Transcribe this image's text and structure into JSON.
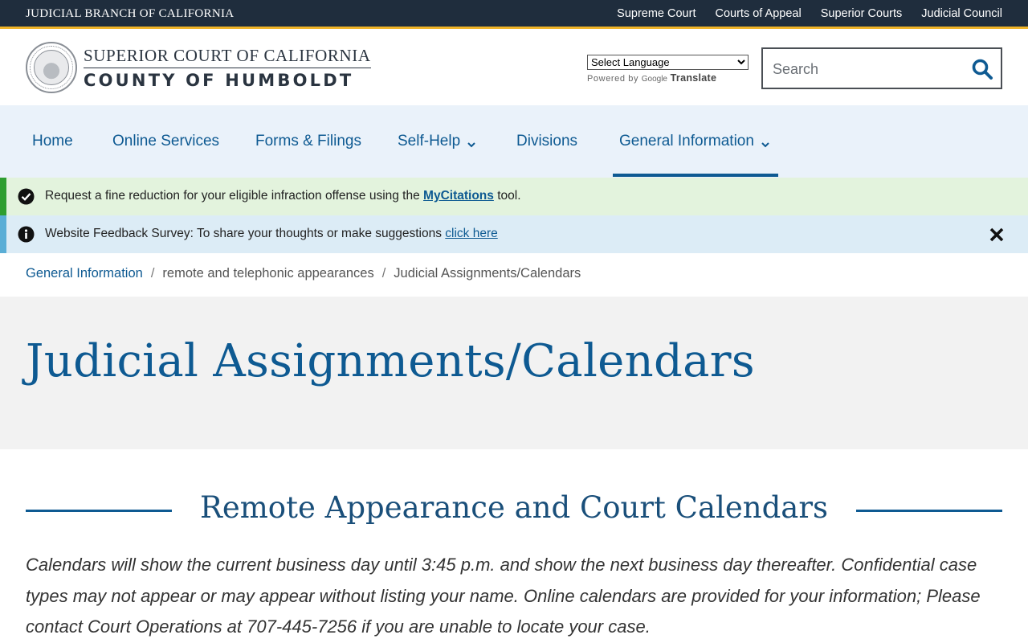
{
  "topbar": {
    "branch": "JUDICIAL BRANCH OF CALIFORNIA",
    "links": [
      "Supreme Court",
      "Courts of Appeal",
      "Superior Courts",
      "Judicial Council"
    ]
  },
  "header": {
    "court_line1": "SUPERIOR COURT OF CALIFORNIA",
    "court_line2": "COUNTY OF HUMBOLDT",
    "translate": {
      "selected": "Select Language",
      "powered_by": "Powered by",
      "google": "Google",
      "translate": "Translate"
    },
    "search": {
      "placeholder": "Search"
    }
  },
  "nav": {
    "items": [
      {
        "label": "Home"
      },
      {
        "label": "Online Services"
      },
      {
        "label": "Forms & Filings"
      },
      {
        "label": "Self-Help"
      },
      {
        "label": "Divisions"
      },
      {
        "label": "General Information"
      }
    ],
    "active": "General Information"
  },
  "alerts": {
    "green": {
      "text_before": "Request  a fine reduction for your eligible infraction offense using the ",
      "link": "MyCitations",
      "text_after": " tool."
    },
    "blue": {
      "text_before": "Website Feedback Survey: To share your thoughts or make suggestions ",
      "link": "click here"
    }
  },
  "breadcrumb": {
    "items": [
      "General Information",
      "remote and telephonic appearances",
      "Judicial Assignments/Calendars"
    ],
    "separator": "/"
  },
  "page": {
    "title": "Judicial Assignments/Calendars",
    "section_title": "Remote Appearance and Court Calendars",
    "body": "Calendars will show the current business day until 3:45 p.m. and show the next business day thereafter.  Confidential case types may not appear or may appear without listing your name.  Online calendars are provided for your information; Please contact Court Operations at 707-445-7256 if you are unable to locate your case."
  },
  "colors": {
    "topbar_bg": "#1f2d3d",
    "accent_gold": "#f0b429",
    "link_blue": "#0e5a92",
    "nav_bg": "#eaf2fa",
    "alert_green_bg": "#e3f3dd",
    "alert_blue_bg": "#dcecf6"
  },
  "icons": {
    "seal": "court-seal-icon",
    "search": "search-icon",
    "chevron": "chevron-down-icon",
    "check": "check-circle-icon",
    "info": "info-circle-icon",
    "close": "close-icon"
  }
}
